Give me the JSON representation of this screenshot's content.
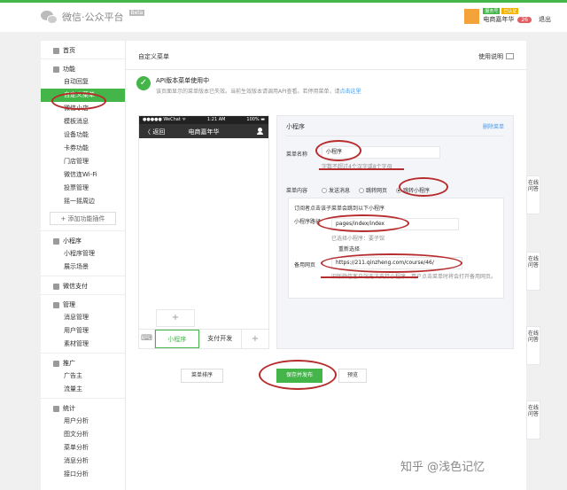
{
  "topbar": {
    "logo_text": "微信·公众平台",
    "beta": "Beta",
    "badge_verified": "服务号",
    "badge_certified": "已认证",
    "account_name": "电商嘉年华",
    "notif_count": "26",
    "logout": "退出"
  },
  "sidebar": {
    "home": "首页",
    "function": "功能",
    "function_items": [
      "自动回复",
      "自定义菜单",
      "微信小店",
      "模板消息",
      "设备功能",
      "卡券功能",
      "门店管理",
      "微信连Wi-Fi",
      "投票管理",
      "摇一摇周边"
    ],
    "add_plugin": "+ 添加功能插件",
    "miniprogram": "小程序",
    "miniprogram_items": [
      "小程序管理",
      "展示场景"
    ],
    "wxpay": "微信支付",
    "manage": "管理",
    "manage_items": [
      "消息管理",
      "用户管理",
      "素材管理"
    ],
    "promote": "推广",
    "promote_items": [
      "广告主",
      "流量主"
    ],
    "stats": "统计",
    "stats_items": [
      "用户分析",
      "图文分析",
      "菜单分析",
      "消息分析",
      "接口分析"
    ]
  },
  "main": {
    "title": "自定义菜单",
    "help": "使用说明",
    "notice_title": "API版本菜单使用中",
    "notice_desc": "该页面显示的菜单版本已失效。当前生效版本请调用API查看。若停用菜单，请",
    "notice_link": "点击这里"
  },
  "phone": {
    "carrier": "●●●●● WeChat ᯤ",
    "time": "1:21 AM",
    "battery": "100% ▬",
    "back": "〈 返回",
    "title": "电商嘉年华",
    "sub_add": "+",
    "kb_icon": "⌨",
    "tabs": [
      "小程序",
      "支付开发"
    ],
    "add": "+"
  },
  "editor": {
    "title": "小程序",
    "delete": "删除菜单",
    "name_label": "菜单名称",
    "name_value": "小程序",
    "name_hint": "字数不超过4个汉字或8个字母",
    "content_label": "菜单内容",
    "options": [
      "发送消息",
      "跳转网页",
      "跳转小程序"
    ],
    "selected": 2,
    "sub_hint": "订阅者点击该子菜单会跳到以下小程序",
    "path_label": "小程序路径",
    "path_value": "pages/index/index",
    "selected_mp": "已选择小程序：要子馆",
    "reselect": "重新选择",
    "backup_label": "备用网页",
    "backup_value": "https://211.qinzheng.com/course/46/",
    "backup_hint": "旧版微信客户端无法支持小程序，用户点击菜单时将会打开备用网页。"
  },
  "side_tabs": [
    "在线问答",
    "在线问答",
    "在线问答",
    "在线问答"
  ],
  "actions": {
    "sort": "菜单排序",
    "save": "保存并发布",
    "preview": "预览"
  },
  "watermark": "知乎 @浅色记忆",
  "colors": {
    "accent": "#44b549",
    "annotation": "#b72d2d",
    "link": "#459ae9"
  }
}
